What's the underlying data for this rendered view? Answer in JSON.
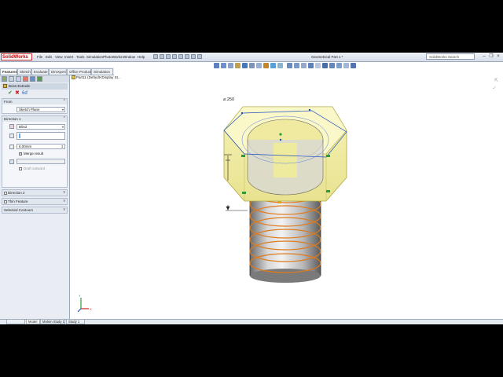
{
  "app": {
    "logo": "SolidWorks",
    "menu": [
      "File",
      "Edit",
      "View",
      "Insert",
      "Tools",
      "Simulation",
      "PhotoWorks",
      "Window",
      "Help"
    ],
    "title": "Geometrical Part 1 *",
    "search_placeholder": "SolidWorks Search"
  },
  "command_tabs": [
    "Features",
    "Sketch",
    "Evaluate",
    "DimXpert",
    "Office Products",
    "Simulation"
  ],
  "tree": {
    "part_label": "Part11 (Default<Display St..."
  },
  "property_manager": {
    "title": "Boss-Extrude",
    "from": {
      "header": "From",
      "value": "Sketch Plane"
    },
    "direction1": {
      "header": "Direction 1",
      "end_condition": "Blind",
      "depth": "6.00mm",
      "merge_label": "Merge result",
      "draft_label": "Draft outward"
    },
    "direction2": {
      "header": "Direction 2"
    },
    "thin": {
      "header": "Thin Feature"
    },
    "selected": {
      "header": "Selected Contours"
    }
  },
  "graphics": {
    "dimension": "⌀.250"
  },
  "bottom_tabs": [
    "Model",
    "Motion Study 1",
    "Study 1"
  ],
  "colors": {
    "background": "#000000",
    "preview_yellow": "#f0ec9a",
    "helix_orange": "#e07a1a",
    "sketch_green": "#2a9d3a"
  }
}
